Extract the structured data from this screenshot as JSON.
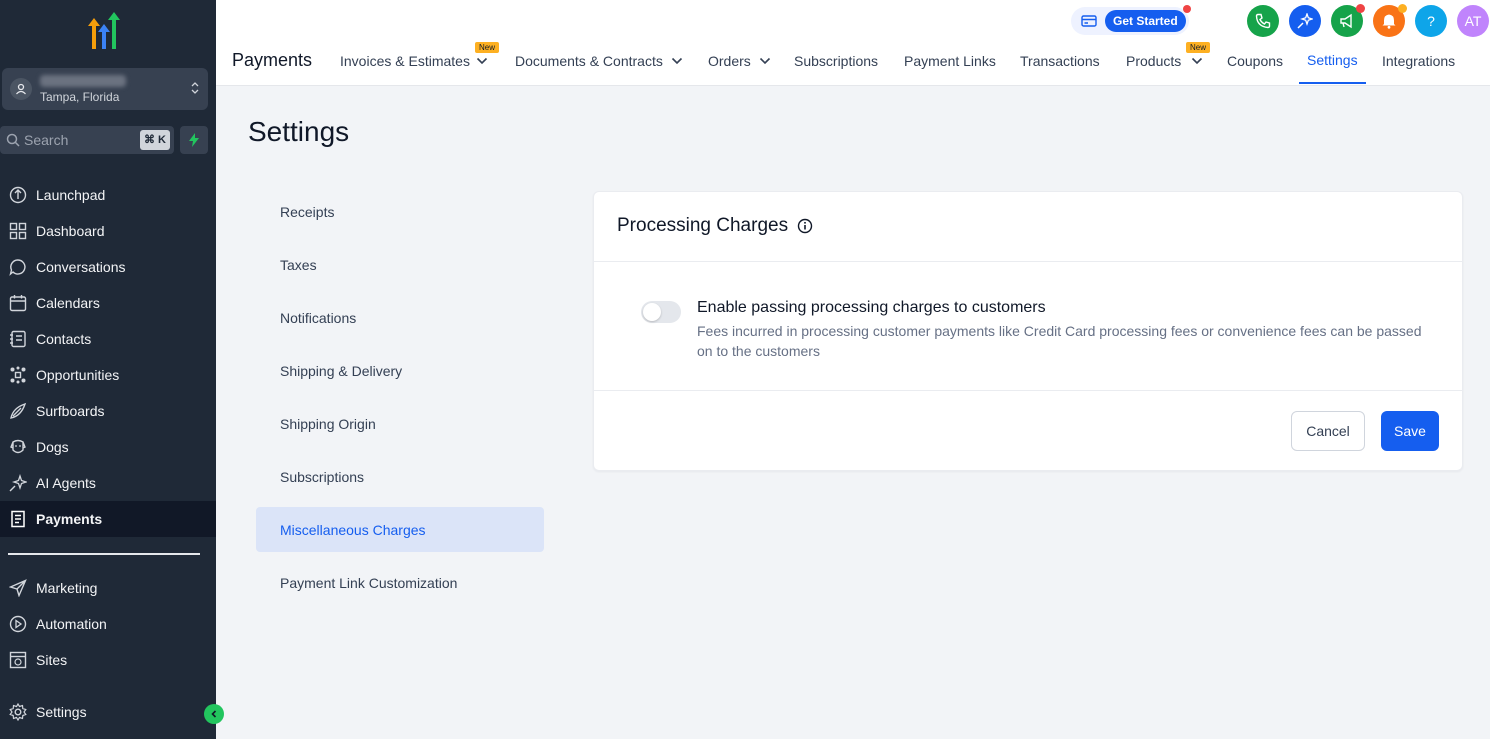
{
  "sidebar": {
    "account_location": "Tampa, Florida",
    "search_placeholder": "Search",
    "search_shortcut": "⌘ K",
    "items": [
      {
        "label": "Launchpad",
        "icon": "launchpad-icon"
      },
      {
        "label": "Dashboard",
        "icon": "dashboard-icon"
      },
      {
        "label": "Conversations",
        "icon": "chat-icon"
      },
      {
        "label": "Calendars",
        "icon": "calendar-icon"
      },
      {
        "label": "Contacts",
        "icon": "contacts-icon"
      },
      {
        "label": "Opportunities",
        "icon": "opportunities-icon"
      },
      {
        "label": "Surfboards",
        "icon": "surfboard-icon"
      },
      {
        "label": "Dogs",
        "icon": "dog-icon"
      },
      {
        "label": "AI Agents",
        "icon": "sparkle-icon"
      },
      {
        "label": "Payments",
        "icon": "receipt-icon",
        "active": true
      },
      {
        "label": "Marketing",
        "icon": "send-icon"
      },
      {
        "label": "Automation",
        "icon": "automation-icon"
      },
      {
        "label": "Sites",
        "icon": "sites-icon"
      },
      {
        "label": "Settings",
        "icon": "gear-icon"
      }
    ]
  },
  "header": {
    "get_started": "Get Started",
    "avatar_initials": "AT",
    "help_glyph": "?",
    "page_name": "Payments",
    "new_badge": "New",
    "tabs": [
      {
        "label": "Invoices & Estimates",
        "dropdown": true,
        "new": true
      },
      {
        "label": "Documents & Contracts",
        "dropdown": true
      },
      {
        "label": "Orders",
        "dropdown": true
      },
      {
        "label": "Subscriptions"
      },
      {
        "label": "Payment Links"
      },
      {
        "label": "Transactions"
      },
      {
        "label": "Products",
        "dropdown": true,
        "new": true
      },
      {
        "label": "Coupons"
      },
      {
        "label": "Settings",
        "active": true
      },
      {
        "label": "Integrations"
      }
    ],
    "colors": {
      "phone": "#16a34a",
      "magic": "#155eef",
      "megaphone": "#16a34a",
      "bell": "#f97316",
      "help": "#0ea5e9",
      "avatar": "#c084fc"
    }
  },
  "main": {
    "title": "Settings",
    "submenu": [
      {
        "label": "Receipts"
      },
      {
        "label": "Taxes"
      },
      {
        "label": "Notifications"
      },
      {
        "label": "Shipping & Delivery"
      },
      {
        "label": "Shipping Origin"
      },
      {
        "label": "Subscriptions"
      },
      {
        "label": "Miscellaneous Charges",
        "active": true
      },
      {
        "label": "Payment Link Customization"
      }
    ],
    "card": {
      "title": "Processing Charges",
      "option_title": "Enable passing processing charges to customers",
      "option_desc": "Fees incurred in processing customer payments like Credit Card processing fees or convenience fees can be passed on to the customers",
      "toggle_on": false,
      "cancel": "Cancel",
      "save": "Save"
    }
  }
}
